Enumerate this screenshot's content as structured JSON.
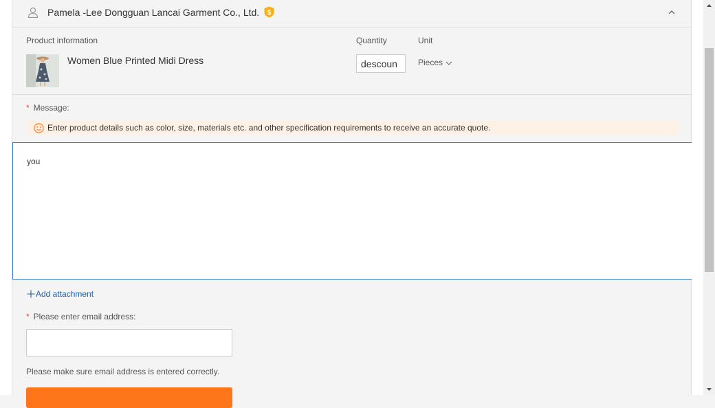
{
  "supplier": {
    "name": "Pamela -Lee Dongguan Lancai Garment Co., Ltd.",
    "badge_icon": "gold-supplier-badge-icon"
  },
  "product": {
    "section_label": "Product information",
    "name": "Women Blue Printed Midi Dress",
    "quantity_label": "Quantity",
    "quantity_value": "descoun",
    "unit_label": "Unit",
    "unit_value": "Pieces"
  },
  "message": {
    "required_mark": "*",
    "label": "Message:",
    "tip": "Enter product details such as color, size, materials etc. and other specification requirements to receive an accurate quote.",
    "value": "you"
  },
  "attachment": {
    "label": "Add attachment"
  },
  "email": {
    "required_mark": "*",
    "label": "Please enter email address:",
    "value": "",
    "hint": "Please make sure email address is entered correctly."
  },
  "colors": {
    "accent": "#ff7519",
    "link": "#1d5fa8",
    "focus_border": "#3f82c6",
    "required": "#e64545",
    "tip_bg": "#fdf0e4"
  }
}
